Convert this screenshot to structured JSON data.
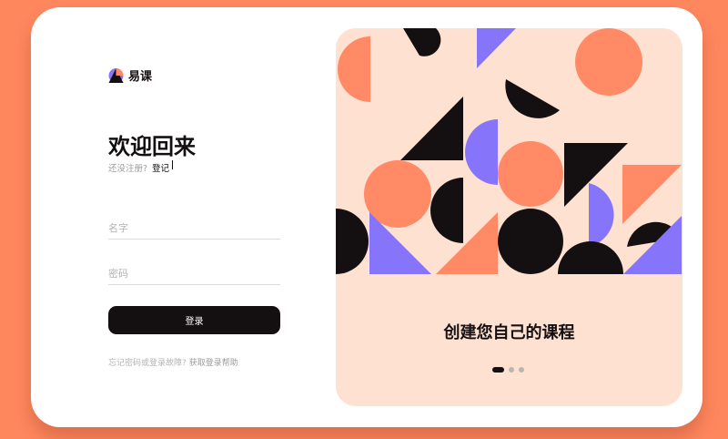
{
  "brand": {
    "name": "易课",
    "logo_icon": "brand-logo-icon"
  },
  "login": {
    "title": "欢迎回来",
    "signup_prompt": "还没注册?",
    "signup_link": "登记",
    "name_placeholder": "名字",
    "password_placeholder": "密码",
    "submit_label": "登录",
    "help_prompt": "忘记密码或登录故障?",
    "help_link": "获取登录帮助"
  },
  "promo": {
    "caption": "创建您自己的课程",
    "carousel": {
      "count": 3,
      "active_index": 0
    }
  },
  "colors": {
    "background": "#ff875e",
    "card": "#ffffff",
    "panel": "#ffe1d2",
    "accent_orange": "#ff8a65",
    "accent_purple": "#8675fb",
    "dark": "#141011"
  }
}
